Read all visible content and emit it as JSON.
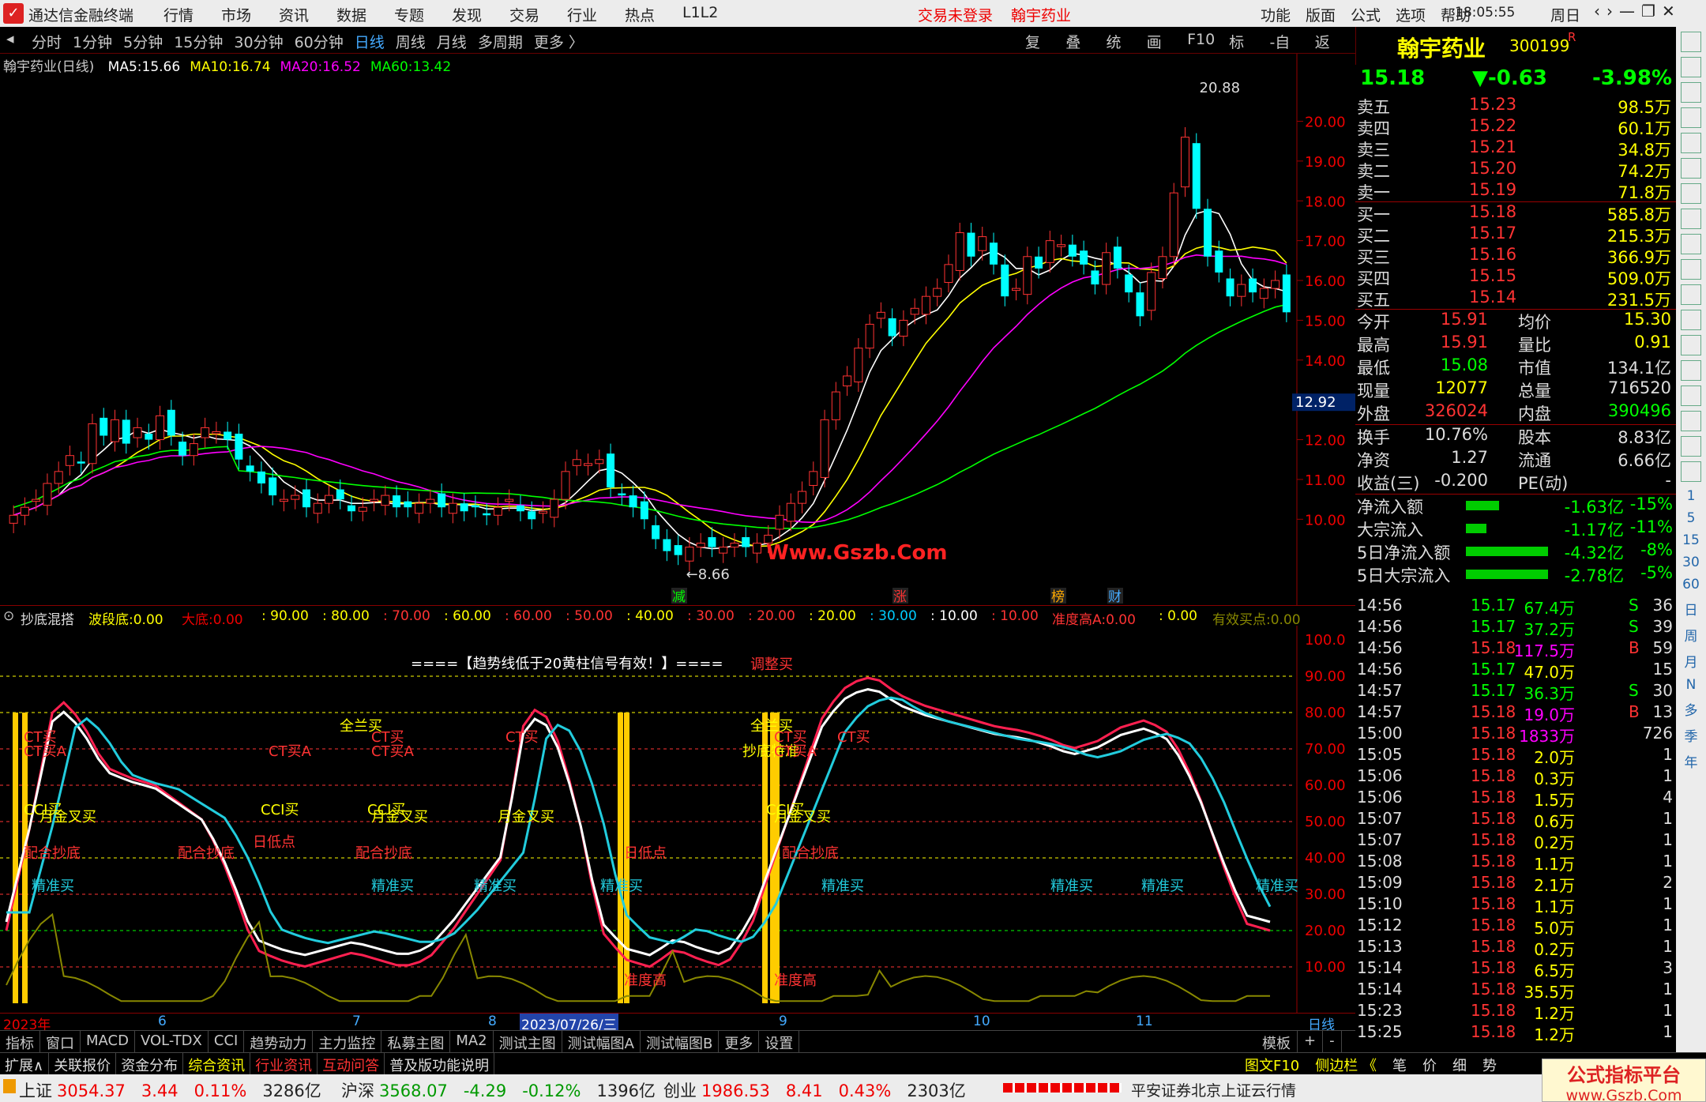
{
  "window": {
    "app_title": "通达信金融终端",
    "menus": [
      "行情",
      "市场",
      "资讯",
      "数据",
      "专题",
      "发现",
      "交易",
      "行业",
      "热点",
      "L1L2"
    ],
    "trade_status": "交易未登录",
    "stock_title": "翰宇药业",
    "right_menus": [
      "功能",
      "版面",
      "公式",
      "选项",
      "帮助"
    ],
    "clock": "18:05:55",
    "weekday": "周日"
  },
  "period_tabs": [
    "分时",
    "1分钟",
    "5分钟",
    "15分钟",
    "30分钟",
    "60分钟",
    "日线",
    "周线",
    "月线",
    "多周期",
    "更多 〉"
  ],
  "active_period": "日线",
  "chart_tools": [
    "复权",
    "叠加",
    "统计",
    "画线",
    "F10",
    "标记",
    "-自选",
    "返回"
  ],
  "main_chart": {
    "label": "翰宇药业(日线)",
    "ma": [
      {
        "name": "MA5:",
        "value": "15.66",
        "color": "#ffffff"
      },
      {
        "name": "MA10:",
        "value": "16.74",
        "color": "#ffff00"
      },
      {
        "name": "MA20:",
        "value": "16.52",
        "color": "#ff00ff"
      },
      {
        "name": "MA60:",
        "value": "13.42",
        "color": "#00ff00"
      }
    ],
    "y_ticks": [
      "20.00",
      "19.00",
      "18.00",
      "17.00",
      "16.00",
      "15.00",
      "14.00",
      "13.00",
      "12.00",
      "11.00",
      "10.00"
    ],
    "current_price_tag": "12.92",
    "high_label": "20.88",
    "low_label": "8.66",
    "watermark": "Www.Gszb.Com",
    "event_marks": [
      {
        "text": "减",
        "color": "#0f0"
      },
      {
        "text": "涨",
        "color": "#f33"
      },
      {
        "text": "榜",
        "color": "#fa0"
      },
      {
        "text": "财",
        "color": "#4af"
      }
    ]
  },
  "chart_data": {
    "type": "candlestick",
    "series": [
      {
        "name": "MA5",
        "color": "#ffffff"
      },
      {
        "name": "MA10",
        "color": "#ffff00"
      },
      {
        "name": "MA20",
        "color": "#ff00ff"
      },
      {
        "name": "MA60",
        "color": "#00ff00"
      }
    ],
    "ylim": [
      8.2,
      21.3
    ],
    "closes": [
      10.1,
      10.3,
      10.5,
      10.9,
      11.2,
      11.6,
      11.4,
      12.4,
      12.1,
      12.5,
      11.9,
      12.3,
      12.0,
      12.6,
      12.1,
      11.6,
      11.9,
      12.3,
      12.2,
      12.0,
      11.5,
      11.2,
      10.9,
      10.6,
      10.5,
      10.6,
      10.3,
      10.4,
      10.6,
      10.5,
      10.2,
      10.3,
      10.5,
      10.6,
      10.3,
      10.3,
      10.4,
      10.5,
      10.3,
      10.4,
      10.2,
      10.3,
      10.1,
      10.3,
      10.5,
      10.2,
      10.0,
      10.2,
      10.5,
      11.2,
      11.5,
      11.4,
      11.5,
      10.8,
      10.6,
      10.3,
      10.0,
      9.5,
      9.2,
      9.1,
      9.3,
      9.4,
      9.3,
      9.3,
      9.4,
      9.3,
      9.4,
      9.6,
      10.1,
      10.4,
      10.7,
      11.2,
      12.5,
      13.2,
      13.6,
      14.3,
      14.9,
      15.2,
      14.6,
      15.0,
      15.3,
      15.6,
      15.8,
      16.4,
      17.2,
      16.6,
      17.1,
      16.4,
      15.6,
      15.8,
      16.6,
      16.3,
      17.0,
      16.9,
      16.6,
      16.4,
      15.9,
      16.7,
      16.3,
      15.7,
      15.1,
      16.2,
      16.6,
      18.2,
      19.6,
      17.8,
      16.6,
      16.2,
      15.6,
      15.9,
      15.7,
      15.8,
      16.0,
      15.2
    ],
    "x_labels": [
      "2023年",
      "6",
      "7",
      "8",
      "9",
      "10",
      "11",
      "日线"
    ],
    "cursor_date": "2023/07/26/三"
  },
  "indicator": {
    "name": "抄底混搭",
    "fields": [
      {
        "name": "波段底:",
        "value": "0.00",
        "color": "#ff0"
      },
      {
        "name": "大底:",
        "value": "0.00",
        "color": "#e00"
      },
      {
        "name": "",
        "value": ": 90.00",
        "color": "#ff0"
      },
      {
        "name": "",
        "value": ": 80.00",
        "color": "#ff0"
      },
      {
        "name": "",
        "value": ": 70.00",
        "color": "#f33"
      },
      {
        "name": "",
        "value": ": 60.00",
        "color": "#ff0"
      },
      {
        "name": "",
        "value": ": 60.00",
        "color": "#f33"
      },
      {
        "name": "",
        "value": ": 50.00",
        "color": "#f33"
      },
      {
        "name": "",
        "value": ": 40.00",
        "color": "#ff0"
      },
      {
        "name": "",
        "value": ": 30.00",
        "color": "#f33"
      },
      {
        "name": "",
        "value": ": 20.00",
        "color": "#f33"
      },
      {
        "name": "",
        "value": ": 20.00",
        "color": "#ff0"
      },
      {
        "name": "",
        "value": ": 30.00",
        "color": "#0cf"
      },
      {
        "name": "",
        "value": ": 10.00",
        "color": "#fff"
      },
      {
        "name": "",
        "value": ": 10.00",
        "color": "#f33"
      },
      {
        "name": "准度高A:",
        "value": "0.00",
        "color": "#f33"
      },
      {
        "name": "",
        "value": ": 0.00",
        "color": "#ff0"
      },
      {
        "name": "有效买点:",
        "value": "0.00",
        "color": "#880"
      }
    ],
    "y_ticks": [
      "100.0",
      "90.00",
      "80.00",
      "70.00",
      "60.00",
      "50.00",
      "40.00",
      "30.00",
      "20.00",
      "10.00"
    ],
    "banner": "====【趋势线低于20黄柱信号有效！】====",
    "signals": [
      "全兰买",
      "全兰买",
      "调整买",
      "抄底特准",
      "CT买",
      "CT买A",
      "CT买",
      "CT买A",
      "CT买",
      "CCI买",
      "CCI买",
      "CCI买",
      "CCI买",
      "CT买A",
      "CT买",
      "CT买",
      "CT买A",
      "月金叉买",
      "月金叉买",
      "月金叉买",
      "月金叉买",
      "配合抄底",
      "配合抄底",
      "配合抄底",
      "配合抄底",
      "精准买",
      "精准买",
      "精准买",
      "精准买",
      "精准买",
      "精准买",
      "精准买",
      "精准买",
      "日低点",
      "日低点",
      "准度高",
      "准度高"
    ]
  },
  "bottom_tabs": [
    "指标",
    "窗口",
    "MACD",
    "VOL-TDX",
    "CCI",
    "趋势动力",
    "主力监控",
    "私募主图",
    "MA2",
    "测试主图",
    "测试幅图A",
    "测试幅图B",
    "更多",
    "设置"
  ],
  "bottom_tabs_right": [
    "模板",
    "+",
    "-"
  ],
  "bottom_tabs2": [
    "扩展∧",
    "关联报价",
    "资金分布",
    "综合资讯",
    "行业资讯",
    "互动问答",
    "普及版功能说明"
  ],
  "bottom_tabs2_right": [
    "图文F10",
    "侧边栏 《",
    "笔",
    "价",
    "细",
    "势"
  ],
  "quote": {
    "name": "翰宇药业",
    "code": "300199",
    "flag": "R",
    "price": "15.18",
    "change": "▼-0.63",
    "pct": "-3.98%",
    "asks": [
      {
        "label": "卖五",
        "price": "15.23",
        "vol": "98.5万"
      },
      {
        "label": "卖四",
        "price": "15.22",
        "vol": "60.1万"
      },
      {
        "label": "卖三",
        "price": "15.21",
        "vol": "34.8万"
      },
      {
        "label": "卖二",
        "price": "15.20",
        "vol": "74.2万"
      },
      {
        "label": "卖一",
        "price": "15.19",
        "vol": "71.8万"
      }
    ],
    "bids": [
      {
        "label": "买一",
        "price": "15.18",
        "vol": "585.8万"
      },
      {
        "label": "买二",
        "price": "15.17",
        "vol": "215.3万"
      },
      {
        "label": "买三",
        "price": "15.16",
        "vol": "366.9万"
      },
      {
        "label": "买四",
        "price": "15.15",
        "vol": "509.0万"
      },
      {
        "label": "买五",
        "price": "15.14",
        "vol": "231.5万"
      }
    ],
    "stats": [
      {
        "l1": "今开",
        "v1": "15.91",
        "c1": "#f33",
        "l2": "均价",
        "v2": "15.30",
        "c2": "#ff0"
      },
      {
        "l1": "最高",
        "v1": "15.91",
        "c1": "#f33",
        "l2": "量比",
        "v2": "0.91",
        "c2": "#ff0"
      },
      {
        "l1": "最低",
        "v1": "15.08",
        "c1": "#0f0",
        "l2": "市值",
        "v2": "134.1亿",
        "c2": "#ddd"
      },
      {
        "l1": "现量",
        "v1": "12077",
        "c1": "#ff0",
        "l2": "总量",
        "v2": "716520",
        "c2": "#ddd"
      },
      {
        "l1": "外盘",
        "v1": "326024",
        "c1": "#f33",
        "l2": "内盘",
        "v2": "390496",
        "c2": "#0f0"
      }
    ],
    "stats2": [
      {
        "l1": "换手",
        "v1": "10.76%",
        "l2": "股本",
        "v2": "8.83亿"
      },
      {
        "l1": "净资",
        "v1": "1.27",
        "l2": "流通",
        "v2": "6.66亿"
      },
      {
        "l1": "收益(三)",
        "v1": "-0.200",
        "l2": "PE(动)",
        "v2": "-"
      }
    ],
    "flows": [
      {
        "label": "净流入额",
        "val": "-1.63亿",
        "pct": "-15%",
        "w": 0.4
      },
      {
        "label": "大宗流入",
        "val": "-1.17亿",
        "pct": "-11%",
        "w": 0.25
      },
      {
        "label": "5日净流入额",
        "val": "-4.32亿",
        "pct": "-8%",
        "w": 1.0
      },
      {
        "label": "5日大宗流入",
        "val": "-2.78亿",
        "pct": "-5%",
        "w": 1.0
      }
    ],
    "ticks": [
      {
        "t": "14:56",
        "p": "15.17",
        "v": "67.4万",
        "s": "S",
        "n": "36"
      },
      {
        "t": "14:56",
        "p": "15.17",
        "v": "37.2万",
        "s": "S",
        "n": "39"
      },
      {
        "t": "14:56",
        "p": "15.18",
        "v": "117.5万",
        "s": "B",
        "n": "59"
      },
      {
        "t": "14:56",
        "p": "15.17",
        "v": "47.0万",
        "s": "",
        "n": "15"
      },
      {
        "t": "14:57",
        "p": "15.17",
        "v": "36.3万",
        "s": "S",
        "n": "30"
      },
      {
        "t": "14:57",
        "p": "15.18",
        "v": "19.0万",
        "s": "B",
        "n": "13"
      },
      {
        "t": "15:00",
        "p": "15.18",
        "v": "1833万",
        "s": "",
        "n": "726"
      },
      {
        "t": "15:05",
        "p": "15.18",
        "v": "2.0万",
        "s": "",
        "n": "1"
      },
      {
        "t": "15:06",
        "p": "15.18",
        "v": "0.3万",
        "s": "",
        "n": "1"
      },
      {
        "t": "15:06",
        "p": "15.18",
        "v": "1.5万",
        "s": "",
        "n": "4"
      },
      {
        "t": "15:07",
        "p": "15.18",
        "v": "0.6万",
        "s": "",
        "n": "1"
      },
      {
        "t": "15:07",
        "p": "15.18",
        "v": "0.2万",
        "s": "",
        "n": "1"
      },
      {
        "t": "15:08",
        "p": "15.18",
        "v": "1.1万",
        "s": "",
        "n": "1"
      },
      {
        "t": "15:09",
        "p": "15.18",
        "v": "2.1万",
        "s": "",
        "n": "2"
      },
      {
        "t": "15:10",
        "p": "15.18",
        "v": "1.1万",
        "s": "",
        "n": "1"
      },
      {
        "t": "15:12",
        "p": "15.18",
        "v": "5.0万",
        "s": "",
        "n": "1"
      },
      {
        "t": "15:13",
        "p": "15.18",
        "v": "0.2万",
        "s": "",
        "n": "1"
      },
      {
        "t": "15:14",
        "p": "15.18",
        "v": "6.5万",
        "s": "",
        "n": "3"
      },
      {
        "t": "15:14",
        "p": "15.18",
        "v": "35.5万",
        "s": "",
        "n": "1"
      },
      {
        "t": "15:23",
        "p": "15.18",
        "v": "1.2万",
        "s": "",
        "n": "1"
      },
      {
        "t": "15:25",
        "p": "15.18",
        "v": "1.2万",
        "s": "",
        "n": "1"
      }
    ]
  },
  "status": {
    "indices": [
      {
        "name": "上证",
        "val": "3054.37",
        "chg": "3.44",
        "pct": "0.11%",
        "amt": "3286亿",
        "c": "#e00"
      },
      {
        "name": "沪深",
        "val": "3568.07",
        "chg": "-4.29",
        "pct": "-0.12%",
        "amt": "1396亿",
        "c": "#090"
      },
      {
        "name": "创业",
        "val": "1986.53",
        "chg": "8.41",
        "pct": "0.43%",
        "amt": "2303亿",
        "c": "#e00"
      }
    ],
    "broker": "平安证券北京上证云行情",
    "badge": "公式指标平台",
    "badge_url": "www.Gszb.Com"
  },
  "sidebar": {
    "labels": [
      "日",
      "周",
      "月",
      "N",
      "多",
      "季",
      "年"
    ],
    "nums": [
      "1",
      "5",
      "15",
      "30",
      "60"
    ]
  }
}
